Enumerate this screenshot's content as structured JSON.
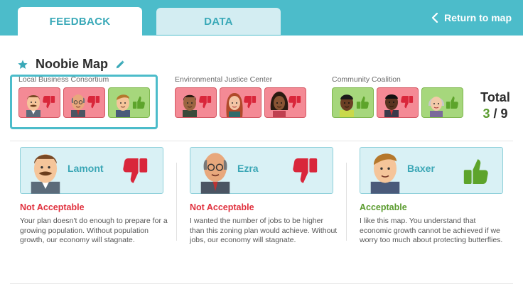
{
  "tabs": [
    {
      "label": "FEEDBACK",
      "active": true
    },
    {
      "label": "DATA",
      "active": false
    }
  ],
  "return_link": {
    "label": "Return to map",
    "icon": "chevron-left-icon"
  },
  "map": {
    "title": "Noobie Map",
    "star_icon": "star-icon",
    "edit_icon": "pencil-icon"
  },
  "groups": [
    {
      "name": "Local Business Consortium",
      "members": [
        {
          "stance": "negative",
          "icon": "thumbs-down-icon"
        },
        {
          "stance": "negative",
          "icon": "thumbs-down-icon"
        },
        {
          "stance": "positive",
          "icon": "thumbs-up-icon"
        }
      ]
    },
    {
      "name": "Environmental Justice Center",
      "members": [
        {
          "stance": "negative",
          "icon": "thumbs-down-icon"
        },
        {
          "stance": "negative",
          "icon": "thumbs-down-icon"
        },
        {
          "stance": "negative",
          "icon": "thumbs-down-icon"
        }
      ]
    },
    {
      "name": "Community Coalition",
      "members": [
        {
          "stance": "positive",
          "icon": "thumbs-up-icon"
        },
        {
          "stance": "negative",
          "icon": "thumbs-down-icon"
        },
        {
          "stance": "positive",
          "icon": "thumbs-up-icon"
        }
      ]
    }
  ],
  "total": {
    "label": "Total",
    "approved": "3",
    "separator": "/",
    "count": "9"
  },
  "stakeholders": [
    {
      "name": "Lamont",
      "verdict": "Not Acceptable",
      "stance": "negative",
      "comment": "Your plan doesn't do enough to prepare for a growing population. Without population growth, our economy will stagnate."
    },
    {
      "name": "Ezra",
      "verdict": "Not Acceptable",
      "stance": "negative",
      "comment": "I wanted the number of jobs to be higher than this zoning plan would achieve. Without jobs, our economy will stagnate."
    },
    {
      "name": "Baxer",
      "verdict": "Acceptable",
      "stance": "positive",
      "comment": "I like this map. You understand that economic growth cannot be achieved if we worry too much about protecting butterflies."
    }
  ],
  "colors": {
    "accent": "#4cbcca",
    "negative": "#e0303d",
    "positive": "#5a9b2e"
  }
}
